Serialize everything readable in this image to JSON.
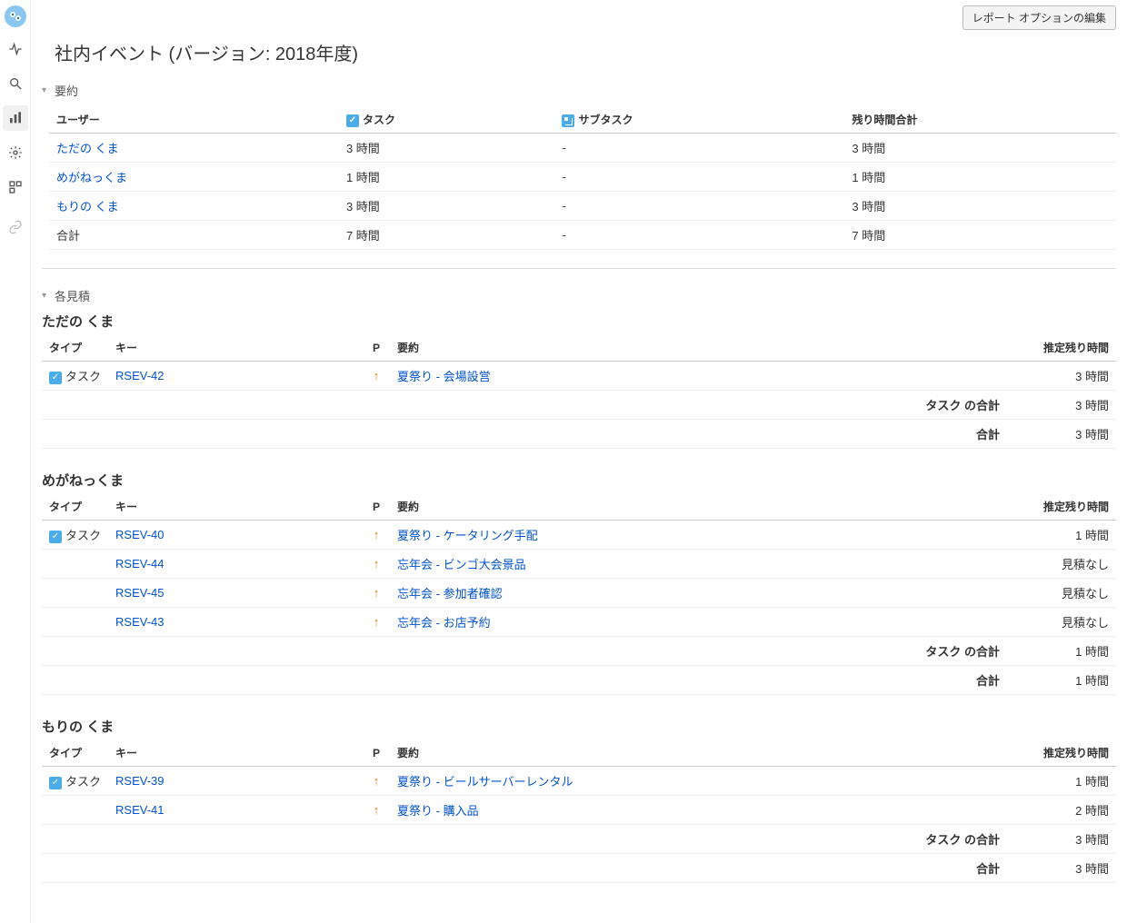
{
  "actions": {
    "edit_report_options": "レポート オプションの編集"
  },
  "page": {
    "title": "社内イベント (バージョン: 2018年度)"
  },
  "sections": {
    "summary_label": "要約",
    "estimates_label": "各見積"
  },
  "summary": {
    "headers": {
      "user": "ユーザー",
      "task": "タスク",
      "subtask": "サブタスク",
      "remaining_total": "残り時間合計"
    },
    "rows": [
      {
        "user": "ただの くま",
        "task": "3 時間",
        "subtask": "-",
        "total": "3 時間"
      },
      {
        "user": "めがねっくま",
        "task": "1 時間",
        "subtask": "-",
        "total": "1 時間"
      },
      {
        "user": "もりの くま",
        "task": "3 時間",
        "subtask": "-",
        "total": "3 時間"
      }
    ],
    "totals_row": {
      "label": "合計",
      "task": "7 時間",
      "subtask": "-",
      "total": "7 時間"
    }
  },
  "estimate_headers": {
    "type": "タイプ",
    "key": "キー",
    "priority": "P",
    "summary": "要約",
    "remaining": "推定残り時間"
  },
  "subtotal_labels": {
    "task_total": "タスク の合計",
    "grand_total": "合計"
  },
  "type_labels": {
    "task": "タスク"
  },
  "users": [
    {
      "name": "ただの くま",
      "tasks": [
        {
          "key": "RSEV-42",
          "summary": "夏祭り - 会場設営",
          "remaining": "3 時間"
        }
      ],
      "task_total": "3 時間",
      "grand_total": "3 時間"
    },
    {
      "name": "めがねっくま",
      "tasks": [
        {
          "key": "RSEV-40",
          "summary": "夏祭り - ケータリング手配",
          "remaining": "1 時間"
        },
        {
          "key": "RSEV-44",
          "summary": "忘年会 - ビンゴ大会景品",
          "remaining": "見積なし"
        },
        {
          "key": "RSEV-45",
          "summary": "忘年会 - 参加者確認",
          "remaining": "見積なし"
        },
        {
          "key": "RSEV-43",
          "summary": "忘年会 - お店予約",
          "remaining": "見積なし"
        }
      ],
      "task_total": "1 時間",
      "grand_total": "1 時間"
    },
    {
      "name": "もりの くま",
      "tasks": [
        {
          "key": "RSEV-39",
          "summary": "夏祭り - ビールサーバーレンタル",
          "remaining": "1 時間"
        },
        {
          "key": "RSEV-41",
          "summary": "夏祭り - 購入品",
          "remaining": "2 時間"
        }
      ],
      "task_total": "3 時間",
      "grand_total": "3 時間"
    }
  ]
}
